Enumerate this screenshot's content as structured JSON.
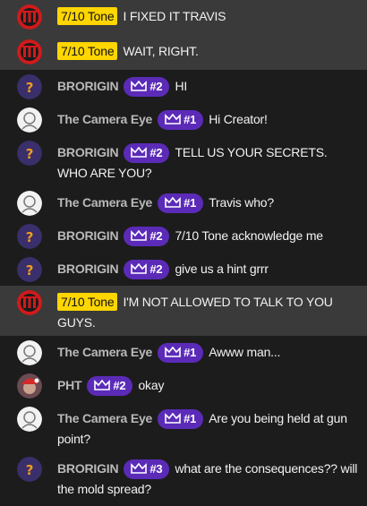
{
  "colors": {
    "background": "#1c1c1c",
    "highlight_row": "#3a3a3a",
    "owner_badge": "#ffd600",
    "member_badge": "#5b2bb8"
  },
  "messages": [
    {
      "author": "7/10 Tone",
      "avatar": "tone",
      "owner": true,
      "text": "I FIXED IT TRAVIS"
    },
    {
      "author": "7/10 Tone",
      "avatar": "tone",
      "owner": true,
      "text": "WAIT, RIGHT."
    },
    {
      "author": "BRORIGIN",
      "avatar": "brorigin",
      "badge": "#2",
      "text": "HI"
    },
    {
      "author": "The Camera Eye",
      "avatar": "camera",
      "badge": "#1",
      "text": "Hi Creator!"
    },
    {
      "author": "BRORIGIN",
      "avatar": "brorigin",
      "badge": "#2",
      "text": "TELL US YOUR SECRETS. WHO ARE YOU?"
    },
    {
      "author": "The Camera Eye",
      "avatar": "camera",
      "badge": "#1",
      "text": "Travis who?"
    },
    {
      "author": "BRORIGIN",
      "avatar": "brorigin",
      "badge": "#2",
      "text": "7/10 Tone acknowledge me"
    },
    {
      "author": "BRORIGIN",
      "avatar": "brorigin",
      "badge": "#2",
      "text": "give us a hint grrr"
    },
    {
      "author": "7/10 Tone",
      "avatar": "tone",
      "owner": true,
      "text": "I'M NOT ALLOWED TO TALK TO YOU GUYS."
    },
    {
      "author": "The Camera Eye",
      "avatar": "camera",
      "badge": "#1",
      "text": "Awww man..."
    },
    {
      "author": "PHT",
      "avatar": "pht",
      "badge": "#2",
      "text": "okay"
    },
    {
      "author": "The Camera Eye",
      "avatar": "camera",
      "badge": "#1",
      "text": "Are you being held at gun point?"
    },
    {
      "author": "BRORIGIN",
      "avatar": "brorigin",
      "badge": "#3",
      "text": "what are the consequences?? will the mold spread?"
    }
  ]
}
